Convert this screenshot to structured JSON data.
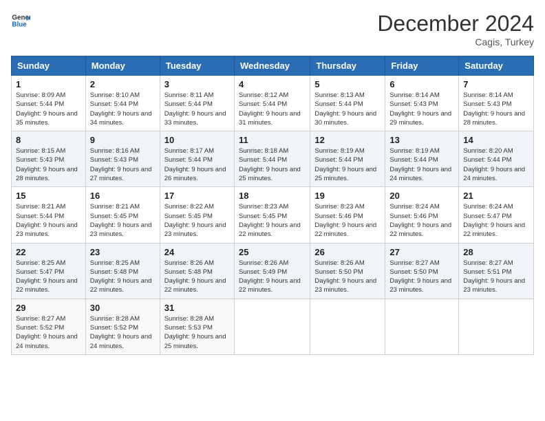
{
  "header": {
    "logo_line1": "General",
    "logo_line2": "Blue",
    "month_title": "December 2024",
    "location": "Cagis, Turkey"
  },
  "columns": [
    "Sunday",
    "Monday",
    "Tuesday",
    "Wednesday",
    "Thursday",
    "Friday",
    "Saturday"
  ],
  "weeks": [
    [
      {
        "day": "1",
        "sunrise": "Sunrise: 8:09 AM",
        "sunset": "Sunset: 5:44 PM",
        "daylight": "Daylight: 9 hours and 35 minutes."
      },
      {
        "day": "2",
        "sunrise": "Sunrise: 8:10 AM",
        "sunset": "Sunset: 5:44 PM",
        "daylight": "Daylight: 9 hours and 34 minutes."
      },
      {
        "day": "3",
        "sunrise": "Sunrise: 8:11 AM",
        "sunset": "Sunset: 5:44 PM",
        "daylight": "Daylight: 9 hours and 33 minutes."
      },
      {
        "day": "4",
        "sunrise": "Sunrise: 8:12 AM",
        "sunset": "Sunset: 5:44 PM",
        "daylight": "Daylight: 9 hours and 31 minutes."
      },
      {
        "day": "5",
        "sunrise": "Sunrise: 8:13 AM",
        "sunset": "Sunset: 5:44 PM",
        "daylight": "Daylight: 9 hours and 30 minutes."
      },
      {
        "day": "6",
        "sunrise": "Sunrise: 8:14 AM",
        "sunset": "Sunset: 5:43 PM",
        "daylight": "Daylight: 9 hours and 29 minutes."
      },
      {
        "day": "7",
        "sunrise": "Sunrise: 8:14 AM",
        "sunset": "Sunset: 5:43 PM",
        "daylight": "Daylight: 9 hours and 28 minutes."
      }
    ],
    [
      {
        "day": "8",
        "sunrise": "Sunrise: 8:15 AM",
        "sunset": "Sunset: 5:43 PM",
        "daylight": "Daylight: 9 hours and 28 minutes."
      },
      {
        "day": "9",
        "sunrise": "Sunrise: 8:16 AM",
        "sunset": "Sunset: 5:43 PM",
        "daylight": "Daylight: 9 hours and 27 minutes."
      },
      {
        "day": "10",
        "sunrise": "Sunrise: 8:17 AM",
        "sunset": "Sunset: 5:44 PM",
        "daylight": "Daylight: 9 hours and 26 minutes."
      },
      {
        "day": "11",
        "sunrise": "Sunrise: 8:18 AM",
        "sunset": "Sunset: 5:44 PM",
        "daylight": "Daylight: 9 hours and 25 minutes."
      },
      {
        "day": "12",
        "sunrise": "Sunrise: 8:19 AM",
        "sunset": "Sunset: 5:44 PM",
        "daylight": "Daylight: 9 hours and 25 minutes."
      },
      {
        "day": "13",
        "sunrise": "Sunrise: 8:19 AM",
        "sunset": "Sunset: 5:44 PM",
        "daylight": "Daylight: 9 hours and 24 minutes."
      },
      {
        "day": "14",
        "sunrise": "Sunrise: 8:20 AM",
        "sunset": "Sunset: 5:44 PM",
        "daylight": "Daylight: 9 hours and 24 minutes."
      }
    ],
    [
      {
        "day": "15",
        "sunrise": "Sunrise: 8:21 AM",
        "sunset": "Sunset: 5:44 PM",
        "daylight": "Daylight: 9 hours and 23 minutes."
      },
      {
        "day": "16",
        "sunrise": "Sunrise: 8:21 AM",
        "sunset": "Sunset: 5:45 PM",
        "daylight": "Daylight: 9 hours and 23 minutes."
      },
      {
        "day": "17",
        "sunrise": "Sunrise: 8:22 AM",
        "sunset": "Sunset: 5:45 PM",
        "daylight": "Daylight: 9 hours and 23 minutes."
      },
      {
        "day": "18",
        "sunrise": "Sunrise: 8:23 AM",
        "sunset": "Sunset: 5:45 PM",
        "daylight": "Daylight: 9 hours and 22 minutes."
      },
      {
        "day": "19",
        "sunrise": "Sunrise: 8:23 AM",
        "sunset": "Sunset: 5:46 PM",
        "daylight": "Daylight: 9 hours and 22 minutes."
      },
      {
        "day": "20",
        "sunrise": "Sunrise: 8:24 AM",
        "sunset": "Sunset: 5:46 PM",
        "daylight": "Daylight: 9 hours and 22 minutes."
      },
      {
        "day": "21",
        "sunrise": "Sunrise: 8:24 AM",
        "sunset": "Sunset: 5:47 PM",
        "daylight": "Daylight: 9 hours and 22 minutes."
      }
    ],
    [
      {
        "day": "22",
        "sunrise": "Sunrise: 8:25 AM",
        "sunset": "Sunset: 5:47 PM",
        "daylight": "Daylight: 9 hours and 22 minutes."
      },
      {
        "day": "23",
        "sunrise": "Sunrise: 8:25 AM",
        "sunset": "Sunset: 5:48 PM",
        "daylight": "Daylight: 9 hours and 22 minutes."
      },
      {
        "day": "24",
        "sunrise": "Sunrise: 8:26 AM",
        "sunset": "Sunset: 5:48 PM",
        "daylight": "Daylight: 9 hours and 22 minutes."
      },
      {
        "day": "25",
        "sunrise": "Sunrise: 8:26 AM",
        "sunset": "Sunset: 5:49 PM",
        "daylight": "Daylight: 9 hours and 22 minutes."
      },
      {
        "day": "26",
        "sunrise": "Sunrise: 8:26 AM",
        "sunset": "Sunset: 5:50 PM",
        "daylight": "Daylight: 9 hours and 23 minutes."
      },
      {
        "day": "27",
        "sunrise": "Sunrise: 8:27 AM",
        "sunset": "Sunset: 5:50 PM",
        "daylight": "Daylight: 9 hours and 23 minutes."
      },
      {
        "day": "28",
        "sunrise": "Sunrise: 8:27 AM",
        "sunset": "Sunset: 5:51 PM",
        "daylight": "Daylight: 9 hours and 23 minutes."
      }
    ],
    [
      {
        "day": "29",
        "sunrise": "Sunrise: 8:27 AM",
        "sunset": "Sunset: 5:52 PM",
        "daylight": "Daylight: 9 hours and 24 minutes."
      },
      {
        "day": "30",
        "sunrise": "Sunrise: 8:28 AM",
        "sunset": "Sunset: 5:52 PM",
        "daylight": "Daylight: 9 hours and 24 minutes."
      },
      {
        "day": "31",
        "sunrise": "Sunrise: 8:28 AM",
        "sunset": "Sunset: 5:53 PM",
        "daylight": "Daylight: 9 hours and 25 minutes."
      },
      null,
      null,
      null,
      null
    ]
  ]
}
